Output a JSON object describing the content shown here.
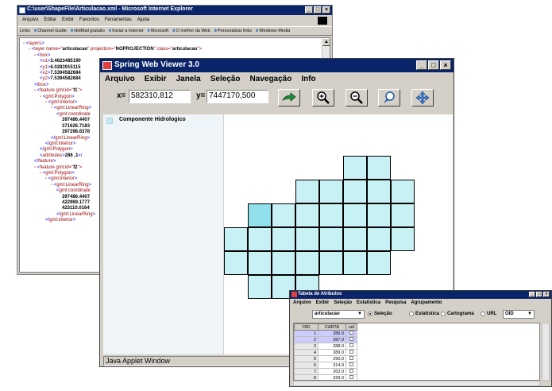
{
  "ie": {
    "title": "C:\\user\\ShapeFile\\Articulacao.xml - Microsoft Internet Explorer",
    "menu": [
      "Arquivo",
      "Editar",
      "Exibir",
      "Favoritos",
      "Ferramentas",
      "Ajuda"
    ],
    "links": [
      "Links",
      "Channel Guide",
      "HotMail gratuito",
      "Iniciar a Internet",
      "Microsoft",
      "O melhor da Web",
      "Personalizar links",
      "Windows Media"
    ],
    "xml_lines": [
      {
        "indent": 0,
        "parts": [
          [
            "m",
            "- "
          ],
          [
            "b",
            "<"
          ],
          [
            "t",
            "layers"
          ],
          [
            "b",
            ">"
          ]
        ]
      },
      {
        "indent": 1,
        "parts": [
          [
            "m",
            "- "
          ],
          [
            "b",
            "<"
          ],
          [
            "t",
            "layer name=\""
          ],
          [
            "v",
            "articulacao"
          ],
          [
            "t",
            "\" projection=\""
          ],
          [
            "v",
            "NOPROJECTION"
          ],
          [
            "t",
            "\" class=\""
          ],
          [
            "v",
            "articulacao"
          ],
          [
            "t",
            "\">"
          ]
        ]
      },
      {
        "indent": 2,
        "parts": [
          [
            "m",
            "- "
          ],
          [
            "b",
            "<"
          ],
          [
            "t",
            "box"
          ],
          [
            "b",
            ">"
          ]
        ]
      },
      {
        "indent": 3,
        "parts": [
          [
            "b",
            "<"
          ],
          [
            "t",
            "x1"
          ],
          [
            "b",
            ">"
          ],
          [
            "v",
            "3.4623485190"
          ]
        ]
      },
      {
        "indent": 3,
        "parts": [
          [
            "b",
            "<"
          ],
          [
            "t",
            "y1"
          ],
          [
            "b",
            ">"
          ],
          [
            "v",
            "6.0283915115"
          ]
        ]
      },
      {
        "indent": 3,
        "parts": [
          [
            "b",
            "<"
          ],
          [
            "t",
            "x2"
          ],
          [
            "b",
            ">"
          ],
          [
            "v",
            "7.5394582684"
          ]
        ]
      },
      {
        "indent": 3,
        "parts": [
          [
            "b",
            "<"
          ],
          [
            "t",
            "y2"
          ],
          [
            "b",
            ">"
          ],
          [
            "v",
            "7.5394582684"
          ]
        ]
      },
      {
        "indent": 2,
        "parts": [
          [
            "b",
            "</"
          ],
          [
            "t",
            "box"
          ],
          [
            "b",
            ">"
          ]
        ]
      },
      {
        "indent": 2,
        "parts": [
          [
            "m",
            "- "
          ],
          [
            "b",
            "<"
          ],
          [
            "t",
            "feature gml:id=\""
          ],
          [
            "v",
            "f1"
          ],
          [
            "t",
            "\">"
          ]
        ]
      },
      {
        "indent": 3,
        "parts": [
          [
            "m",
            "- "
          ],
          [
            "b",
            "<"
          ],
          [
            "t",
            "gml:Polygon"
          ],
          [
            "b",
            ">"
          ]
        ]
      },
      {
        "indent": 4,
        "parts": [
          [
            "m",
            "- "
          ],
          [
            "b",
            "<"
          ],
          [
            "t",
            "gml:interior"
          ],
          [
            "b",
            ">"
          ]
        ]
      },
      {
        "indent": 5,
        "parts": [
          [
            "m",
            "- "
          ],
          [
            "b",
            "<"
          ],
          [
            "t",
            "gml:LinearRing"
          ],
          [
            "b",
            ">"
          ]
        ]
      },
      {
        "indent": 6,
        "parts": [
          [
            "b",
            "<"
          ],
          [
            "t",
            "gml:coordinate"
          ]
        ]
      },
      {
        "indent": 7,
        "parts": [
          [
            "v",
            "397486.4407"
          ]
        ]
      },
      {
        "indent": 7,
        "parts": [
          [
            "v",
            "371626.7183"
          ]
        ]
      },
      {
        "indent": 7,
        "parts": [
          [
            "v",
            "397298.6378"
          ]
        ]
      },
      {
        "indent": 5,
        "parts": [
          [
            "b",
            "</"
          ],
          [
            "t",
            "gml:LinearRing"
          ],
          [
            "b",
            ">"
          ]
        ]
      },
      {
        "indent": 4,
        "parts": [
          [
            "b",
            "</"
          ],
          [
            "t",
            "gml:interior"
          ],
          [
            "b",
            ">"
          ]
        ]
      },
      {
        "indent": 3,
        "parts": [
          [
            "b",
            "</"
          ],
          [
            "t",
            "gml:Polygon"
          ],
          [
            "b",
            ">"
          ]
        ]
      },
      {
        "indent": 3,
        "parts": [
          [
            "b",
            "<"
          ],
          [
            "t",
            "attributes"
          ],
          [
            "b",
            ">"
          ],
          [
            "v",
            "286 ,1"
          ],
          [
            "b",
            "</"
          ]
        ]
      },
      {
        "indent": 2,
        "parts": [
          [
            "b",
            "</"
          ],
          [
            "t",
            "feature"
          ],
          [
            "b",
            ">"
          ]
        ]
      },
      {
        "indent": 2,
        "parts": [
          [
            "m",
            "- "
          ],
          [
            "b",
            "<"
          ],
          [
            "t",
            "feature gml:id=\""
          ],
          [
            "v",
            "f2"
          ],
          [
            "t",
            "\">"
          ]
        ]
      },
      {
        "indent": 3,
        "parts": [
          [
            "m",
            "- "
          ],
          [
            "b",
            "<"
          ],
          [
            "t",
            "gml:Polygon"
          ],
          [
            "b",
            ">"
          ]
        ]
      },
      {
        "indent": 4,
        "parts": [
          [
            "m",
            "- "
          ],
          [
            "b",
            "<"
          ],
          [
            "t",
            "gml:interior"
          ],
          [
            "b",
            ">"
          ]
        ]
      },
      {
        "indent": 5,
        "parts": [
          [
            "m",
            "- "
          ],
          [
            "b",
            "<"
          ],
          [
            "t",
            "gml:LinearRing"
          ],
          [
            "b",
            ">"
          ]
        ]
      },
      {
        "indent": 6,
        "parts": [
          [
            "b",
            "<"
          ],
          [
            "t",
            "gml:coordinate"
          ]
        ]
      },
      {
        "indent": 7,
        "parts": [
          [
            "v",
            "397486.4407"
          ]
        ]
      },
      {
        "indent": 7,
        "parts": [
          [
            "v",
            "422969.1777"
          ]
        ]
      },
      {
        "indent": 7,
        "parts": [
          [
            "v",
            "423110.0164"
          ]
        ]
      },
      {
        "indent": 6,
        "parts": [
          [
            "b",
            "</"
          ],
          [
            "t",
            "gml:LinearRing"
          ],
          [
            "b",
            ">"
          ]
        ]
      },
      {
        "indent": 4,
        "parts": [
          [
            "b",
            "</"
          ],
          [
            "t",
            "gml:interior"
          ],
          [
            "b",
            ">"
          ]
        ]
      }
    ]
  },
  "spring": {
    "title": "Spring Web Viewer 3.0",
    "menu": [
      "Arquivo",
      "Exibir",
      "Janela",
      "Seleção",
      "Navegação",
      "Info"
    ],
    "x_label": "x=",
    "x_value": "582310,812",
    "y_label": "y=",
    "y_value": "7447170,500",
    "tools": [
      "go-arrow-icon",
      "zoom-in-icon",
      "zoom-out-icon",
      "pan-icon",
      "move-icon"
    ],
    "legend_label": "Componente Hidrologico",
    "status": "Java Applet Window",
    "map_cells": [
      {
        "c": 5,
        "r": 0
      },
      {
        "c": 6,
        "r": 0
      },
      {
        "c": 3,
        "r": 1
      },
      {
        "c": 4,
        "r": 1
      },
      {
        "c": 5,
        "r": 1
      },
      {
        "c": 6,
        "r": 1
      },
      {
        "c": 7,
        "r": 1
      },
      {
        "c": 1,
        "r": 2,
        "dark": true
      },
      {
        "c": 2,
        "r": 2
      },
      {
        "c": 3,
        "r": 2
      },
      {
        "c": 4,
        "r": 2
      },
      {
        "c": 5,
        "r": 2
      },
      {
        "c": 6,
        "r": 2
      },
      {
        "c": 7,
        "r": 2
      },
      {
        "c": 0,
        "r": 3
      },
      {
        "c": 1,
        "r": 3
      },
      {
        "c": 2,
        "r": 3
      },
      {
        "c": 3,
        "r": 3
      },
      {
        "c": 4,
        "r": 3
      },
      {
        "c": 5,
        "r": 3
      },
      {
        "c": 6,
        "r": 3
      },
      {
        "c": 7,
        "r": 3
      },
      {
        "c": 0,
        "r": 4
      },
      {
        "c": 1,
        "r": 4
      },
      {
        "c": 2,
        "r": 4
      },
      {
        "c": 3,
        "r": 4
      },
      {
        "c": 4,
        "r": 4
      },
      {
        "c": 5,
        "r": 4
      },
      {
        "c": 6,
        "r": 4
      },
      {
        "c": 1,
        "r": 5
      },
      {
        "c": 2,
        "r": 5
      },
      {
        "c": 3,
        "r": 5
      }
    ]
  },
  "tabela": {
    "title": "Tabela de Atributos",
    "menu": [
      "Arquivo",
      "Exibir",
      "Seleção",
      "Estatística",
      "Pesquisa",
      "Agrupamento"
    ],
    "layer_select": "articulacao",
    "radios": [
      {
        "label": "Seleção",
        "checked": true
      },
      {
        "label": "Estatística",
        "checked": false
      },
      {
        "label": "Cartograma",
        "checked": false
      },
      {
        "label": "URL",
        "checked": false
      }
    ],
    "field_select": "OID",
    "columns": [
      "OID",
      "CARTA",
      "sel"
    ],
    "rows": [
      {
        "oid": "1",
        "carta": "286.0",
        "selected": true
      },
      {
        "oid": "2",
        "carta": "287.0",
        "selected": true
      },
      {
        "oid": "3",
        "carta": "288.0",
        "selected": false
      },
      {
        "oid": "4",
        "carta": "289.0",
        "selected": false
      },
      {
        "oid": "5",
        "carta": "290.0",
        "selected": false
      },
      {
        "oid": "6",
        "carta": "314.0",
        "selected": false
      },
      {
        "oid": "7",
        "carta": "262.0",
        "selected": false
      },
      {
        "oid": "8",
        "carta": "239.0",
        "selected": false
      }
    ]
  }
}
